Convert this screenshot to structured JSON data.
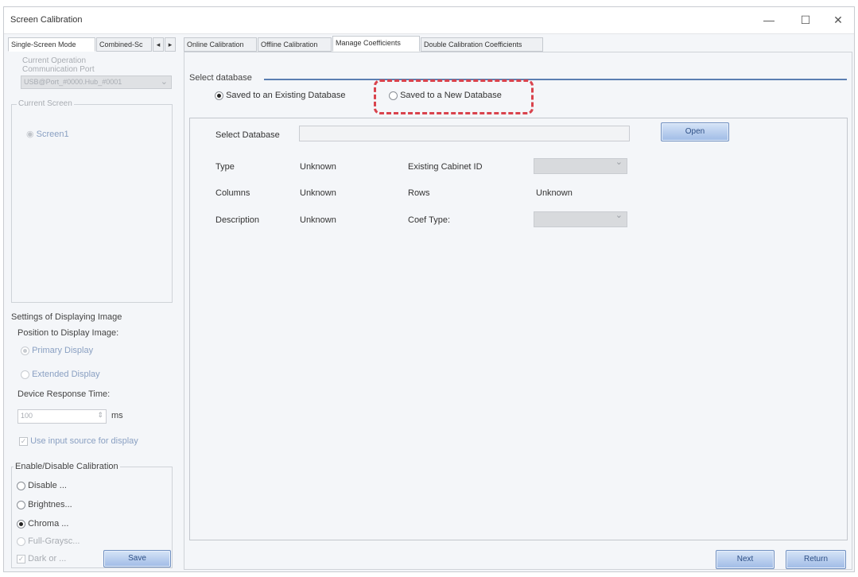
{
  "window": {
    "title": "Screen Calibration",
    "controls": {
      "minimize": "—",
      "maximize": "☐",
      "close": "✕"
    }
  },
  "left_tabs": [
    "Single-Screen Mode",
    "Combined-Sc"
  ],
  "left_tab_arrows": [
    "◂",
    "▸"
  ],
  "right_tabs": [
    "Online Calibration",
    "Offline Calibration",
    "Manage Coefficients",
    "Double Calibration Coefficients"
  ],
  "current_operation": {
    "label": "Current Operation",
    "port_label": "Communication Port",
    "port_value": "USB@Port_#0000.Hub_#0001"
  },
  "current_screen": {
    "label": "Current Screen",
    "items": [
      "Screen1"
    ]
  },
  "display_settings": {
    "label": "Settings of Displaying Image",
    "position_label": "Position to Display Image:",
    "options": [
      "Primary Display",
      "Extended Display"
    ],
    "response_label": "Device Response Time:",
    "response_value": "100",
    "response_unit": "ms",
    "use_input_label": "Use input source for display"
  },
  "calibration": {
    "label": "Enable/Disable Calibration",
    "options": [
      "Disable ...",
      "Brightnes...",
      "Chroma ...",
      "Full-Graysc..."
    ],
    "dark_label": "Dark or ...",
    "save_label": "Save"
  },
  "select_db": {
    "label": "Select database",
    "option_existing": "Saved to an Existing Database",
    "option_new": "Saved to a New Database",
    "highlight_color": "#d9434d"
  },
  "details": {
    "select_db_label": "Select Database",
    "open_label": "Open",
    "type_label": "Type",
    "type_value": "Unknown",
    "cabinet_label": "Existing Cabinet ID",
    "columns_label": "Columns",
    "columns_value": "Unknown",
    "rows_label": "Rows",
    "rows_value": "Unknown",
    "desc_label": "Description",
    "desc_value": "Unknown",
    "coef_label": "Coef Type:"
  },
  "footer": {
    "next_label": "Next",
    "return_label": "Return"
  },
  "colors": {
    "accent": "#9fbbe6",
    "window_bg": "#f4f6f9",
    "panel_border": "#cfd3d8"
  }
}
